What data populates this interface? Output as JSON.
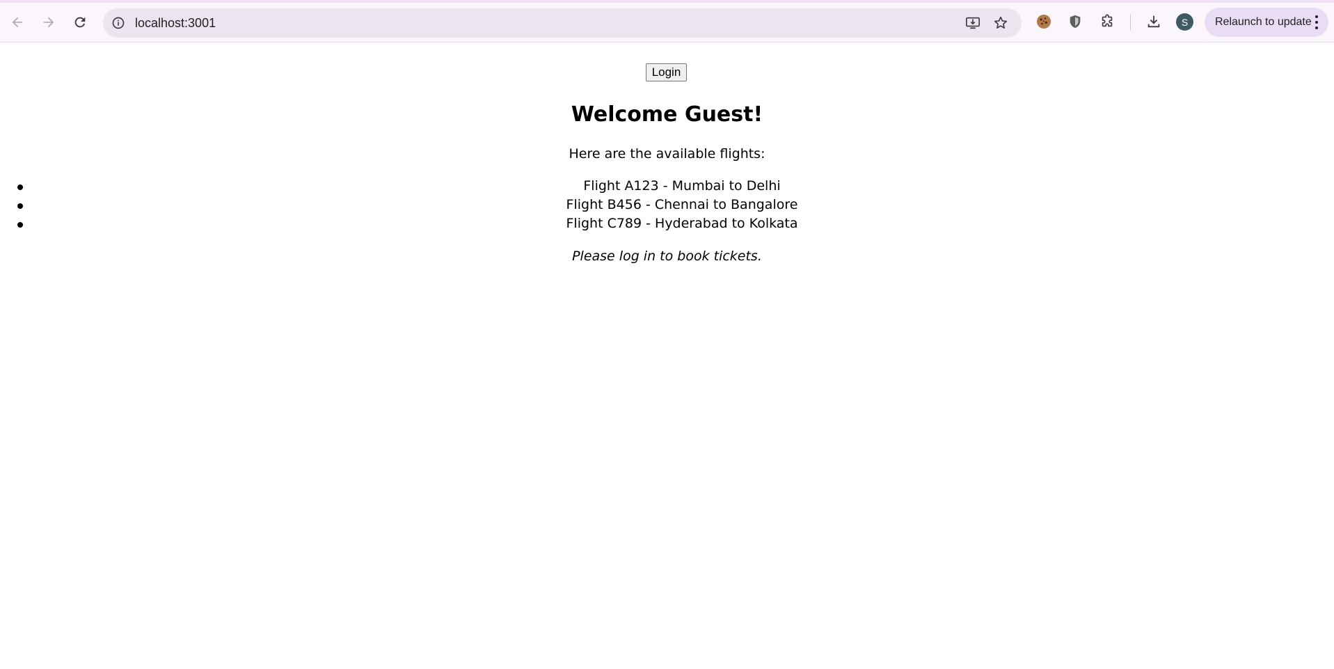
{
  "browser": {
    "url": "localhost:3001",
    "profile_initial": "S",
    "relaunch_label": "Relaunch to update",
    "icons": {
      "back": "arrow-left-icon",
      "forward": "arrow-right-icon",
      "reload": "reload-icon",
      "site_info": "info-icon",
      "install": "install-app-icon",
      "bookmark": "star-icon",
      "extension_cookie": "cookie-icon",
      "extension_shield": "shield-icon",
      "extensions": "puzzle-icon",
      "downloads": "download-icon",
      "menu": "more-vert-icon"
    },
    "colors": {
      "chrome_bg": "#fbf5fc",
      "omnibox_bg": "#ece4ef",
      "relaunch_bg": "#eadcf5",
      "avatar_bg": "#3f5a63"
    }
  },
  "page": {
    "login_label": "Login",
    "title": "Welcome Guest!",
    "intro": "Here are the available flights:",
    "flights": [
      "Flight A123 - Mumbai to Delhi",
      "Flight B456 - Chennai to Bangalore",
      "Flight C789 - Hyderabad to Kolkata"
    ],
    "notice": "Please log in to book tickets."
  }
}
